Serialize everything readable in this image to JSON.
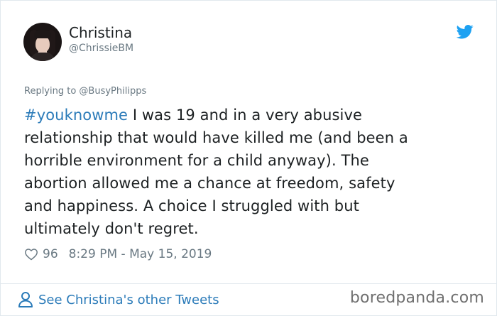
{
  "author": {
    "name": "Christina",
    "handle": "@ChrissieBM"
  },
  "tweet": {
    "replying_to": "Replying to @BusyPhilipps",
    "hashtag": "#youknowme",
    "lines": [
      " I was 19 and in a very abusive",
      "relationship that would have killed me (and been a",
      "horrible environment for a child anyway). The",
      "abortion allowed me a chance at freedom, safety",
      "and happiness. A choice I struggled with but",
      "ultimately don't regret."
    ],
    "likes": "96",
    "timestamp": "8:29 PM - May 15, 2019"
  },
  "footer": {
    "see_tweets_label": "See Christina's other Tweets",
    "watermark": "boredpanda.com"
  },
  "icons": {
    "logo": "twitter-bird-icon",
    "like": "heart-outline-icon",
    "profile": "person-outline-icon"
  },
  "colors": {
    "link": "#2b7bb9",
    "twitter_blue": "#1da1f2",
    "secondary_text": "#697882",
    "main_text": "#1c2022",
    "border": "#e1e8ed"
  }
}
